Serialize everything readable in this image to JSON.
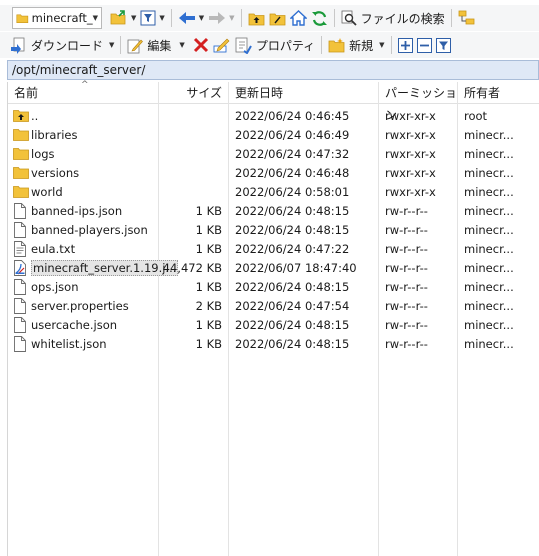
{
  "toolbar1": {
    "location_combo": "minecraft_",
    "find_files": "ファイルの検索"
  },
  "toolbar2": {
    "download": "ダウンロード",
    "edit": "編集",
    "properties": "プロパティ",
    "new": "新規"
  },
  "path": "/opt/minecraft_server/",
  "columns": {
    "name": "名前",
    "size": "サイズ",
    "modified": "更新日時",
    "permissions": "パーミッション",
    "owner": "所有者"
  },
  "files": [
    {
      "name": "..",
      "size": "",
      "modified": "2022/06/24 0:46:45",
      "perm": "rwxr-xr-x",
      "owner": "root",
      "icon": "parent-folder-icon"
    },
    {
      "name": "libraries",
      "size": "",
      "modified": "2022/06/24 0:46:49",
      "perm": "rwxr-xr-x",
      "owner": "minecr...",
      "icon": "folder-icon"
    },
    {
      "name": "logs",
      "size": "",
      "modified": "2022/06/24 0:47:32",
      "perm": "rwxr-xr-x",
      "owner": "minecr...",
      "icon": "folder-icon"
    },
    {
      "name": "versions",
      "size": "",
      "modified": "2022/06/24 0:46:48",
      "perm": "rwxr-xr-x",
      "owner": "minecr...",
      "icon": "folder-icon"
    },
    {
      "name": "world",
      "size": "",
      "modified": "2022/06/24 0:58:01",
      "perm": "rwxr-xr-x",
      "owner": "minecr...",
      "icon": "folder-icon"
    },
    {
      "name": "banned-ips.json",
      "size": "1 KB",
      "modified": "2022/06/24 0:48:15",
      "perm": "rw-r--r--",
      "owner": "minecr...",
      "icon": "file-icon"
    },
    {
      "name": "banned-players.json",
      "size": "1 KB",
      "modified": "2022/06/24 0:48:15",
      "perm": "rw-r--r--",
      "owner": "minecr...",
      "icon": "file-icon"
    },
    {
      "name": "eula.txt",
      "size": "1 KB",
      "modified": "2022/06/24 0:47:22",
      "perm": "rw-r--r--",
      "owner": "minecr...",
      "icon": "text-file-icon"
    },
    {
      "name": "minecraft_server.1.19.j...",
      "size": "44,472 KB",
      "modified": "2022/06/07 18:47:40",
      "perm": "rw-r--r--",
      "owner": "minecr...",
      "icon": "jar-file-icon",
      "selected": true
    },
    {
      "name": "ops.json",
      "size": "1 KB",
      "modified": "2022/06/24 0:48:15",
      "perm": "rw-r--r--",
      "owner": "minecr...",
      "icon": "file-icon"
    },
    {
      "name": "server.properties",
      "size": "2 KB",
      "modified": "2022/06/24 0:47:54",
      "perm": "rw-r--r--",
      "owner": "minecr...",
      "icon": "file-icon"
    },
    {
      "name": "usercache.json",
      "size": "1 KB",
      "modified": "2022/06/24 0:48:15",
      "perm": "rw-r--r--",
      "owner": "minecr...",
      "icon": "file-icon"
    },
    {
      "name": "whitelist.json",
      "size": "1 KB",
      "modified": "2022/06/24 0:48:15",
      "perm": "rw-r--r--",
      "owner": "minecr...",
      "icon": "file-icon"
    }
  ],
  "colors": {
    "folder": "#f2c23a",
    "path_bar": "#dfe8f6",
    "accent_green": "#1a9a3a",
    "accent_blue": "#2f6fd1",
    "delete_red": "#d42020"
  }
}
